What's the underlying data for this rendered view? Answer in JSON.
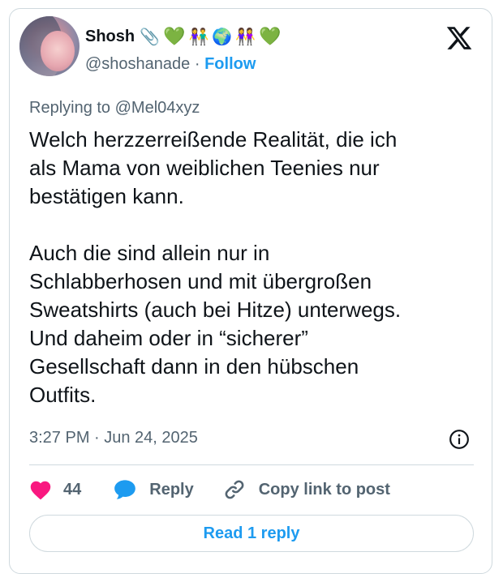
{
  "author": {
    "display_name": "Shosh",
    "emojis": [
      "📎",
      "💚",
      "👫",
      "🌍",
      "👭",
      "💚"
    ],
    "handle": "@shoshanade",
    "separator": " · ",
    "follow_label": "Follow"
  },
  "reply_context": "Replying to @Mel04xyz",
  "tweet": {
    "text": "Welch herzzerreißende Realität, die ich\nals Mama von weiblichen Teenies nur\nbestätigen kann.\n\nAuch die sind allein nur in\nSchlabberhosen und mit übergroßen\nSweatshirts (auch bei Hitze) unterwegs.\nUnd daheim oder in “sicherer”\nGesellschaft dann in den hübschen\nOutfits.",
    "timestamp": "3:27 PM · Jun 24, 2025"
  },
  "actions": {
    "like_count": "44",
    "reply_label": "Reply",
    "copy_label": "Copy link to post"
  },
  "read_reply_label": "Read 1 reply",
  "colors": {
    "accent": "#1d9bf0",
    "like": "#f91880",
    "text": "#0f1419",
    "secondary": "#536471",
    "border": "#cfd9de"
  },
  "icons": [
    "x-logo-icon",
    "info-icon",
    "heart-icon",
    "reply-bubble-icon",
    "link-icon"
  ]
}
